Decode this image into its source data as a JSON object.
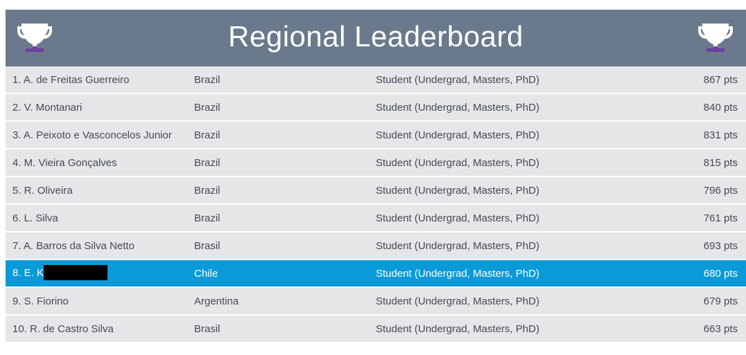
{
  "header": {
    "title": "Regional Leaderboard",
    "left_icon": "trophy-icon",
    "right_icon": "trophy-icon"
  },
  "colors": {
    "header_bg": "#6a7a8c",
    "row_bg": "#e6e6e9",
    "highlight_bg": "#0a9ad8",
    "trophy_cup": "#ffffff",
    "trophy_base": "#6b3fa0"
  },
  "rows": [
    {
      "name": "1. A. de Freitas Guerreiro",
      "country": "Brazil",
      "category": "Student (Undergrad, Masters, PhD)",
      "points": "867 pts"
    },
    {
      "name": "2. V. Montanari",
      "country": "Brazil",
      "category": "Student (Undergrad, Masters, PhD)",
      "points": "840 pts"
    },
    {
      "name": "3. A. Peixoto e Vasconcelos Junior",
      "country": "Brazil",
      "category": "Student (Undergrad, Masters, PhD)",
      "points": "831 pts"
    },
    {
      "name": "4. M. Vieira Gonçalves",
      "country": "Brazil",
      "category": "Student (Undergrad, Masters, PhD)",
      "points": "815 pts"
    },
    {
      "name": "5. R. Oliveira",
      "country": "Brazil",
      "category": "Student (Undergrad, Masters, PhD)",
      "points": "796 pts"
    },
    {
      "name": "6. L. Silva",
      "country": "Brazil",
      "category": "Student (Undergrad, Masters, PhD)",
      "points": "761 pts"
    },
    {
      "name": "7. A. Barros da Silva Netto",
      "country": "Brasil",
      "category": "Student (Undergrad, Masters, PhD)",
      "points": "693 pts"
    },
    {
      "name": "8. E. K",
      "country": "Chile",
      "category": "Student (Undergrad, Masters, PhD)",
      "points": "680 pts"
    },
    {
      "name": "9. S. Fiorino",
      "country": "Argentina",
      "category": "Student (Undergrad, Masters, PhD)",
      "points": "679 pts"
    },
    {
      "name": "10. R. de Castro Silva",
      "country": "Brasil",
      "category": "Student (Undergrad, Masters, PhD)",
      "points": "663 pts"
    }
  ]
}
